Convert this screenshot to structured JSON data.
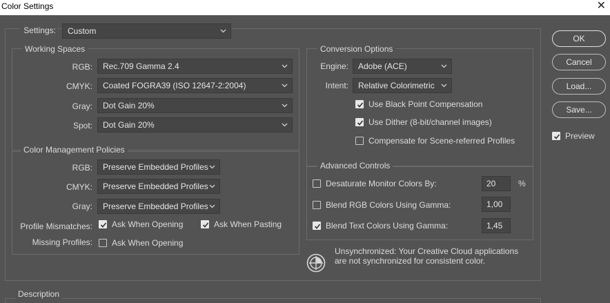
{
  "window": {
    "title": "Color Settings",
    "close_glyph": "✕"
  },
  "settings": {
    "label": "Settings:",
    "value": "Custom"
  },
  "working_spaces": {
    "legend": "Working Spaces",
    "rgb": {
      "label": "RGB:",
      "value": "Rec.709 Gamma 2.4"
    },
    "cmyk": {
      "label": "CMYK:",
      "value": "Coated FOGRA39 (ISO 12647-2:2004)"
    },
    "gray": {
      "label": "Gray:",
      "value": "Dot Gain 20%"
    },
    "spot": {
      "label": "Spot:",
      "value": "Dot Gain 20%"
    }
  },
  "policies": {
    "legend": "Color Management Policies",
    "rgb": {
      "label": "RGB:",
      "value": "Preserve Embedded Profiles"
    },
    "cmyk": {
      "label": "CMYK:",
      "value": "Preserve Embedded Profiles"
    },
    "gray": {
      "label": "Gray:",
      "value": "Preserve Embedded Profiles"
    },
    "mismatches": {
      "label": "Profile Mismatches:",
      "ask_opening": {
        "label": "Ask When Opening",
        "checked": true
      },
      "ask_pasting": {
        "label": "Ask When Pasting",
        "checked": true
      }
    },
    "missing": {
      "label": "Missing Profiles:",
      "ask_opening": {
        "label": "Ask When Opening",
        "checked": false
      }
    }
  },
  "conversion": {
    "legend": "Conversion Options",
    "engine": {
      "label": "Engine:",
      "value": "Adobe (ACE)"
    },
    "intent": {
      "label": "Intent:",
      "value": "Relative Colorimetric"
    },
    "black_point": {
      "label": "Use Black Point Compensation",
      "checked": true
    },
    "dither": {
      "label": "Use Dither (8-bit/channel images)",
      "checked": true
    },
    "scene_referred": {
      "label": "Compensate for Scene-referred Profiles",
      "checked": false
    }
  },
  "advanced": {
    "legend": "Advanced Controls",
    "desaturate": {
      "label": "Desaturate Monitor Colors By:",
      "value": "20",
      "unit": "%",
      "checked": false
    },
    "blend_rgb": {
      "label": "Blend RGB Colors Using Gamma:",
      "value": "1,00",
      "checked": false
    },
    "blend_text": {
      "label": "Blend Text Colors Using Gamma:",
      "value": "1,45",
      "checked": true
    }
  },
  "sync": {
    "icon": "sync-status-icon",
    "message_line1": "Unsynchronized: Your Creative Cloud applications",
    "message_line2": "are not synchronized for consistent color."
  },
  "description": {
    "legend": "Description"
  },
  "buttons": {
    "ok": "OK",
    "cancel": "Cancel",
    "load": "Load...",
    "save": "Save..."
  },
  "preview": {
    "label": "Preview",
    "checked": true
  }
}
